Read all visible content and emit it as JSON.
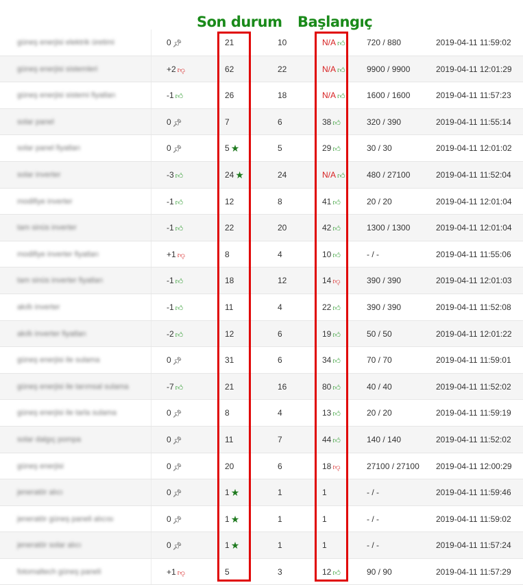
{
  "headers": {
    "son_durum": "Son durum",
    "baslangic": "Başlangıç"
  },
  "colors": {
    "highlight": "#e00000",
    "header_green": "#1a8a1a",
    "up": "#2e9a2e",
    "down": "#d61f1f"
  },
  "rows": [
    {
      "keyword": "güneş enerjisi elektrik üretimi",
      "change": "0",
      "change_icon": "pin",
      "current": "21",
      "current_icon": "",
      "best": "10",
      "start": "N/A",
      "start_icon": "up",
      "volume": "720 / 880",
      "date": "2019-04-11 11:59:02"
    },
    {
      "keyword": "güneş enerjisi sistemleri",
      "change": "+2",
      "change_icon": "down",
      "current": "62",
      "current_icon": "",
      "best": "22",
      "start": "N/A",
      "start_icon": "up",
      "volume": "9900 / 9900",
      "date": "2019-04-11 12:01:29"
    },
    {
      "keyword": "güneş enerjisi sistemi fiyatları",
      "change": "-1",
      "change_icon": "up",
      "current": "26",
      "current_icon": "",
      "best": "18",
      "start": "N/A",
      "start_icon": "up",
      "volume": "1600 / 1600",
      "date": "2019-04-11 11:57:23"
    },
    {
      "keyword": "solar panel",
      "change": "0",
      "change_icon": "pin",
      "current": "7",
      "current_icon": "",
      "best": "6",
      "start": "38",
      "start_icon": "up",
      "volume": "320 / 390",
      "date": "2019-04-11 11:55:14"
    },
    {
      "keyword": "solar panel fiyatları",
      "change": "0",
      "change_icon": "pin",
      "current": "5",
      "current_icon": "star",
      "best": "5",
      "start": "29",
      "start_icon": "up",
      "volume": "30 / 30",
      "date": "2019-04-11 12:01:02"
    },
    {
      "keyword": "solar inverter",
      "change": "-3",
      "change_icon": "up",
      "current": "24",
      "current_icon": "star",
      "best": "24",
      "start": "N/A",
      "start_icon": "up",
      "volume": "480 / 27100",
      "date": "2019-04-11 11:52:04"
    },
    {
      "keyword": "modifiye inverter",
      "change": "-1",
      "change_icon": "up",
      "current": "12",
      "current_icon": "",
      "best": "8",
      "start": "41",
      "start_icon": "up",
      "volume": "20 / 20",
      "date": "2019-04-11 12:01:04"
    },
    {
      "keyword": "tam sinüs inverter",
      "change": "-1",
      "change_icon": "up",
      "current": "22",
      "current_icon": "",
      "best": "20",
      "start": "42",
      "start_icon": "up",
      "volume": "1300 / 1300",
      "date": "2019-04-11 12:01:04"
    },
    {
      "keyword": "modifiye inverter fiyatları",
      "change": "+1",
      "change_icon": "down",
      "current": "8",
      "current_icon": "",
      "best": "4",
      "start": "10",
      "start_icon": "up",
      "volume": "- / -",
      "date": "2019-04-11 11:55:06"
    },
    {
      "keyword": "tam sinüs inverter fiyatları",
      "change": "-1",
      "change_icon": "up",
      "current": "18",
      "current_icon": "",
      "best": "12",
      "start": "14",
      "start_icon": "down",
      "volume": "390 / 390",
      "date": "2019-04-11 12:01:03"
    },
    {
      "keyword": "akıllı inverter",
      "change": "-1",
      "change_icon": "up",
      "current": "11",
      "current_icon": "",
      "best": "4",
      "start": "22",
      "start_icon": "up",
      "volume": "390 / 390",
      "date": "2019-04-11 11:52:08"
    },
    {
      "keyword": "akıllı inverter fiyatları",
      "change": "-2",
      "change_icon": "up",
      "current": "12",
      "current_icon": "",
      "best": "6",
      "start": "19",
      "start_icon": "up",
      "volume": "50 / 50",
      "date": "2019-04-11 12:01:22"
    },
    {
      "keyword": "güneş enerjisi ile sulama",
      "change": "0",
      "change_icon": "pin",
      "current": "31",
      "current_icon": "",
      "best": "6",
      "start": "34",
      "start_icon": "up",
      "volume": "70 / 70",
      "date": "2019-04-11 11:59:01"
    },
    {
      "keyword": "güneş enerjisi ile tarımsal sulama",
      "change": "-7",
      "change_icon": "up",
      "current": "21",
      "current_icon": "",
      "best": "16",
      "start": "80",
      "start_icon": "up",
      "volume": "40 / 40",
      "date": "2019-04-11 11:52:02"
    },
    {
      "keyword": "güneş enerjisi ile tarla sulama",
      "change": "0",
      "change_icon": "pin",
      "current": "8",
      "current_icon": "",
      "best": "4",
      "start": "13",
      "start_icon": "up",
      "volume": "20 / 20",
      "date": "2019-04-11 11:59:19"
    },
    {
      "keyword": "solar dalgıç pompa",
      "change": "0",
      "change_icon": "pin",
      "current": "11",
      "current_icon": "",
      "best": "7",
      "start": "44",
      "start_icon": "up",
      "volume": "140 / 140",
      "date": "2019-04-11 11:52:02"
    },
    {
      "keyword": "güneş enerjisi",
      "change": "0",
      "change_icon": "pin",
      "current": "20",
      "current_icon": "",
      "best": "6",
      "start": "18",
      "start_icon": "down",
      "volume": "27100 / 27100",
      "date": "2019-04-11 12:00:29"
    },
    {
      "keyword": "jeneratör alıcı",
      "change": "0",
      "change_icon": "pin",
      "current": "1",
      "current_icon": "star",
      "best": "1",
      "start": "1",
      "start_icon": "",
      "volume": "- / -",
      "date": "2019-04-11 11:59:46"
    },
    {
      "keyword": "jeneratör güneş paneli alıcısı",
      "change": "0",
      "change_icon": "pin",
      "current": "1",
      "current_icon": "star",
      "best": "1",
      "start": "1",
      "start_icon": "",
      "volume": "- / -",
      "date": "2019-04-11 11:59:02"
    },
    {
      "keyword": "jeneratör solar alıcı",
      "change": "0",
      "change_icon": "pin",
      "current": "1",
      "current_icon": "star",
      "best": "1",
      "start": "1",
      "start_icon": "",
      "volume": "- / -",
      "date": "2019-04-11 11:57:24"
    },
    {
      "keyword": "fotomaltech güneş paneli",
      "change": "+1",
      "change_icon": "down",
      "current": "5",
      "current_icon": "",
      "best": "3",
      "start": "12",
      "start_icon": "up",
      "volume": "90 / 90",
      "date": "2019-04-11 11:57:29"
    }
  ]
}
